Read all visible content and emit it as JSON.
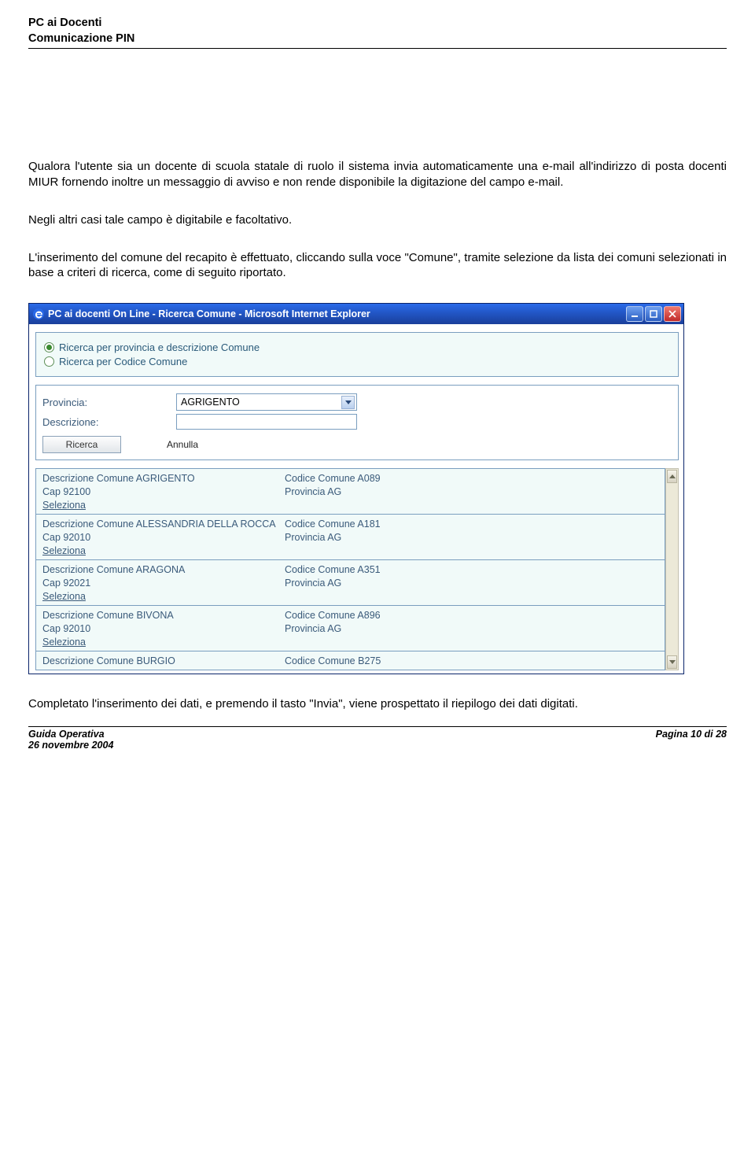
{
  "header": {
    "line1": "PC ai Docenti",
    "line2": "Comunicazione PIN"
  },
  "paragraphs": {
    "p1": "Qualora l'utente sia un docente di scuola statale di ruolo il sistema invia automaticamente una e-mail all'indirizzo di posta docenti MIUR fornendo inoltre un messaggio di avviso e non rende disponibile la digitazione del campo e-mail.",
    "p2": "Negli altri casi tale campo è digitabile e facoltativo.",
    "p3": "L'inserimento del comune del recapito è effettuato, cliccando sulla voce \"Comune\", tramite selezione da lista dei comuni selezionati in base a criteri di ricerca, come di seguito riportato.",
    "p4": "Completato l'inserimento dei dati, e premendo il tasto \"Invia\", viene prospettato il riepilogo dei dati digitati."
  },
  "win": {
    "title": "PC ai docenti On Line - Ricerca Comune - Microsoft Internet Explorer",
    "radio": {
      "opt1": "Ricerca per provincia e descrizione Comune",
      "opt2": "Ricerca per Codice Comune"
    },
    "form": {
      "provincia_label": "Provincia:",
      "provincia_value": "AGRIGENTO",
      "descrizione_label": "Descrizione:",
      "btn_ricerca": "Ricerca",
      "btn_annulla": "Annulla"
    },
    "labels": {
      "desc_comune": "Descrizione Comune",
      "codice_comune": "Codice Comune",
      "cap": "Cap",
      "provincia": "Provincia",
      "seleziona": "Seleziona"
    },
    "results": [
      {
        "desc": "AGRIGENTO",
        "codice": "A089",
        "cap": "92100",
        "prov": "AG"
      },
      {
        "desc": "ALESSANDRIA DELLA ROCCA",
        "codice": "A181",
        "cap": "92010",
        "prov": "AG"
      },
      {
        "desc": "ARAGONA",
        "codice": "A351",
        "cap": "92021",
        "prov": "AG"
      },
      {
        "desc": "BIVONA",
        "codice": "A896",
        "cap": "92010",
        "prov": "AG"
      },
      {
        "desc": "BURGIO",
        "codice": "B275",
        "cap": "",
        "prov": ""
      }
    ]
  },
  "footer": {
    "guide": "Guida Operativa",
    "date": "26 novembre 2004",
    "page": "Pagina 10 di 28"
  }
}
